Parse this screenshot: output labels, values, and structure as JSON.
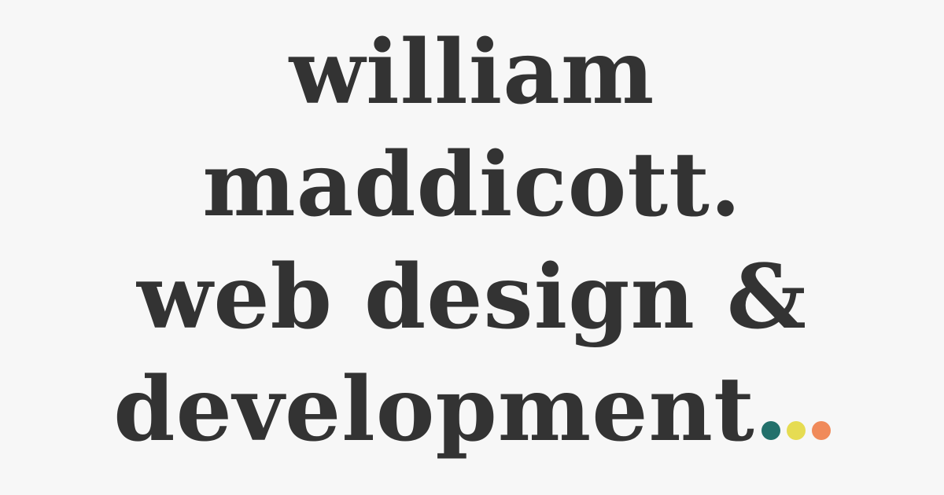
{
  "headline": {
    "lines": [
      "william",
      "maddicott.",
      "web design &",
      "development"
    ]
  },
  "dots": {
    "colors": [
      "#23706b",
      "#e6dc52",
      "#f08a5a"
    ]
  }
}
